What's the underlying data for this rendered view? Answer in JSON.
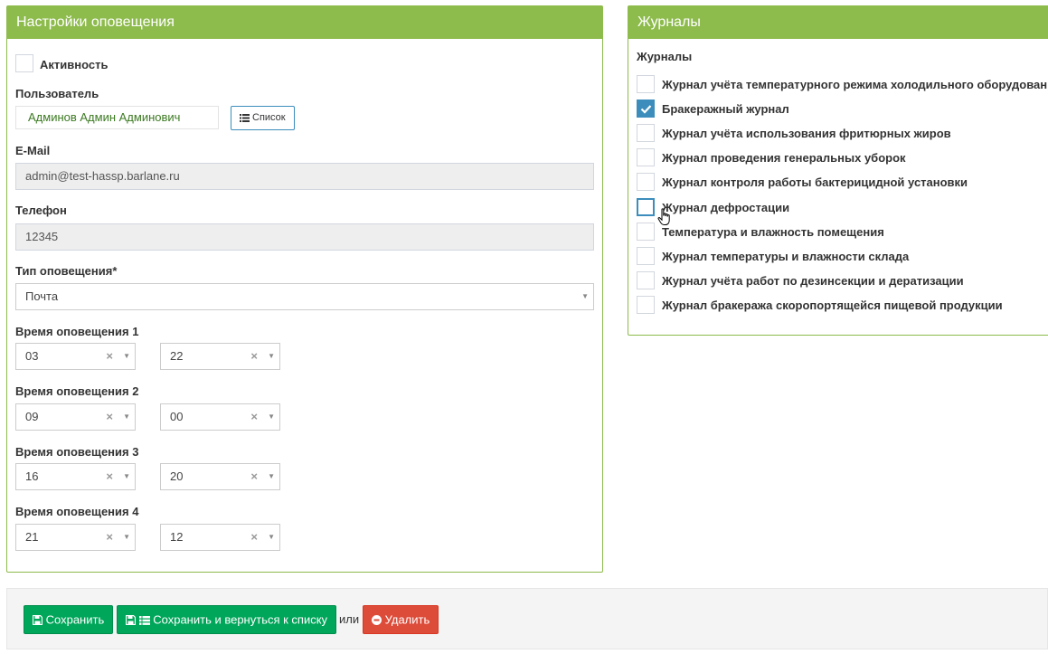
{
  "left_panel": {
    "title": "Настройки оповещения",
    "activity_label": "Активность",
    "user_label": "Пользователь",
    "user_value": "Админов Админ Админович",
    "list_button": "Список",
    "email_label": "E-Mail",
    "email_value": "admin@test-hassp.barlane.ru",
    "phone_label": "Телефон",
    "phone_value": "12345",
    "notify_type_label": "Тип оповещения*",
    "notify_type_value": "Почта",
    "times": [
      {
        "label": "Время оповещения 1",
        "hour": "03",
        "minute": "22"
      },
      {
        "label": "Время оповещения 2",
        "hour": "09",
        "minute": "00"
      },
      {
        "label": "Время оповещения 3",
        "hour": "16",
        "minute": "20"
      },
      {
        "label": "Время оповещения 4",
        "hour": "21",
        "minute": "12"
      }
    ],
    "clear_glyph": "×",
    "arrow_glyph": "▼"
  },
  "right_panel": {
    "title": "Журналы",
    "subtitle": "Журналы",
    "journals": [
      {
        "label": "Журнал учёта температурного режима холодильного оборудования",
        "checked": false
      },
      {
        "label": "Бракеражный журнал",
        "checked": true
      },
      {
        "label": "Журнал учёта использования фритюрных жиров",
        "checked": false
      },
      {
        "label": "Журнал проведения генеральных уборок",
        "checked": false
      },
      {
        "label": "Журнал контроля работы бактерицидной установки",
        "checked": false
      },
      {
        "label": "Журнал дефростации",
        "checked": false
      },
      {
        "label": "Температура и влажность помещения",
        "checked": false
      },
      {
        "label": "Журнал температуры и влажности склада",
        "checked": false
      },
      {
        "label": "Журнал учёта работ по дезинсекции и дератизации",
        "checked": false
      },
      {
        "label": "Журнал бракеража скоропортящейся пищевой продукции",
        "checked": false
      }
    ]
  },
  "footer": {
    "save_label": "Сохранить",
    "save_return_label": "Сохранить и вернуться к списку",
    "or_label": "или",
    "delete_label": "Удалить"
  },
  "colors": {
    "panel_header": "#8dbb4c",
    "checkbox_checked": "#3c8dbc",
    "save_button": "#00a65a",
    "delete_button": "#dd4b39"
  }
}
